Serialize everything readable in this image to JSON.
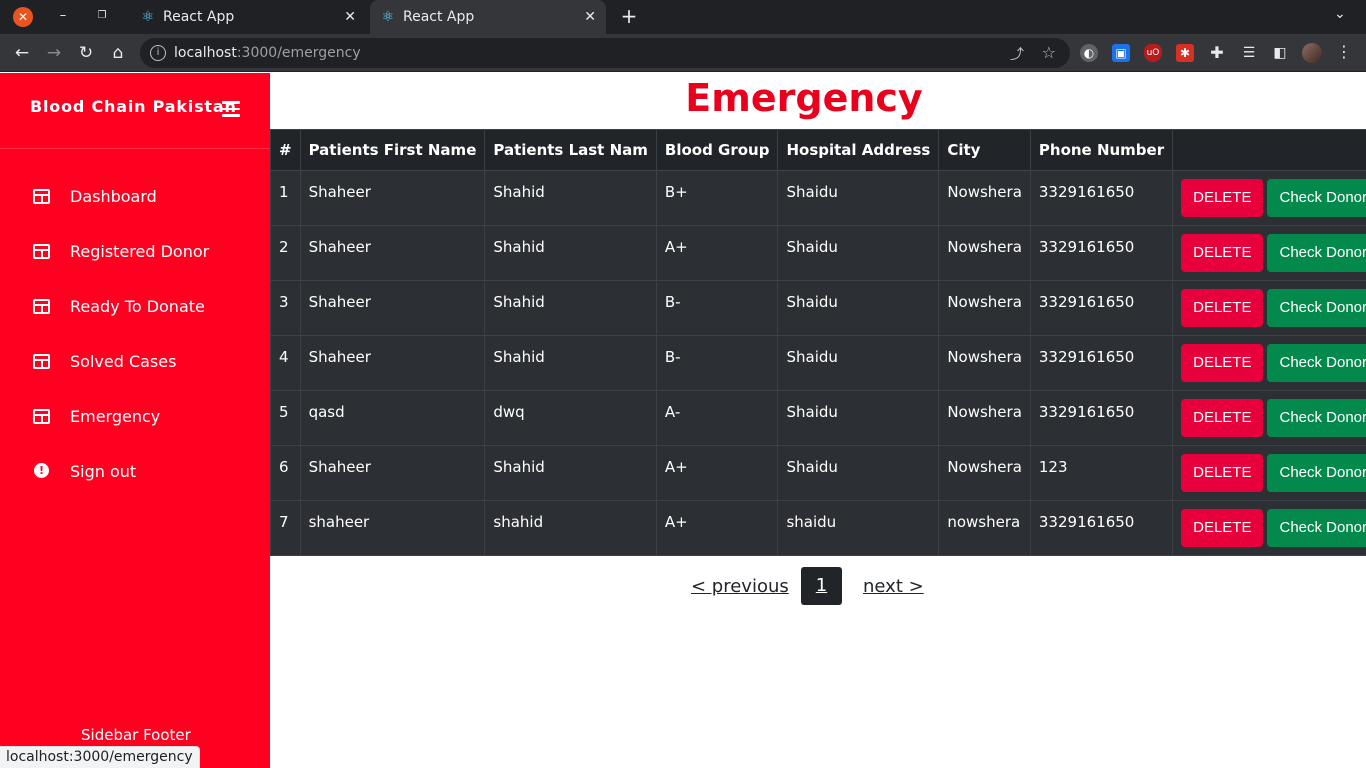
{
  "browser": {
    "tabs": [
      {
        "title": "React App",
        "active": false
      },
      {
        "title": "React App",
        "active": true
      }
    ],
    "address_host": "localhost",
    "address_path": ":3000/emergency",
    "status_url": "localhost:3000/emergency"
  },
  "sidebar": {
    "brand": "Blood Chain Pakistan",
    "items": [
      {
        "label": "Dashboard",
        "icon": "table-icon"
      },
      {
        "label": "Registered Donor",
        "icon": "table-icon"
      },
      {
        "label": "Ready To Donate",
        "icon": "table-icon"
      },
      {
        "label": "Solved Cases",
        "icon": "table-icon"
      },
      {
        "label": "Emergency",
        "icon": "table-icon"
      },
      {
        "label": "Sign out",
        "icon": "exclamation-circle-icon"
      }
    ],
    "footer": "Sidebar Footer"
  },
  "main": {
    "title": "Emergency",
    "columns": [
      "#",
      "Patients First Name",
      "Patients Last Nam",
      "Blood Group",
      "Hospital Address",
      "City",
      "Phone Number",
      ""
    ],
    "rows": [
      {
        "no": "1",
        "first": "Shaheer",
        "last": "Shahid",
        "blood": "B+",
        "hospital": "Shaidu",
        "city": "Nowshera",
        "phone": "3329161650"
      },
      {
        "no": "2",
        "first": "Shaheer",
        "last": "Shahid",
        "blood": "A+",
        "hospital": "Shaidu",
        "city": "Nowshera",
        "phone": "3329161650"
      },
      {
        "no": "3",
        "first": "Shaheer",
        "last": "Shahid",
        "blood": "B-",
        "hospital": "Shaidu",
        "city": "Nowshera",
        "phone": "3329161650"
      },
      {
        "no": "4",
        "first": "Shaheer",
        "last": "Shahid",
        "blood": "B-",
        "hospital": "Shaidu",
        "city": "Nowshera",
        "phone": "3329161650"
      },
      {
        "no": "5",
        "first": "qasd",
        "last": "dwq",
        "blood": "A-",
        "hospital": "Shaidu",
        "city": "Nowshera",
        "phone": "3329161650"
      },
      {
        "no": "6",
        "first": "Shaheer",
        "last": "Shahid",
        "blood": "A+",
        "hospital": "Shaidu",
        "city": "Nowshera",
        "phone": "123"
      },
      {
        "no": "7",
        "first": "shaheer",
        "last": "shahid",
        "blood": "A+",
        "hospital": "shaidu",
        "city": "nowshera",
        "phone": "3329161650"
      }
    ],
    "delete_label": "DELETE",
    "check_label": "Check Donor",
    "pagination": {
      "prev": "< previous",
      "current": "1",
      "next": "next >"
    }
  },
  "colors": {
    "sidebar": "#ff0020",
    "title": "#e8001c",
    "delete_button": "#e8003d",
    "check_button": "#03894c",
    "table_bg": "#2c3034"
  }
}
